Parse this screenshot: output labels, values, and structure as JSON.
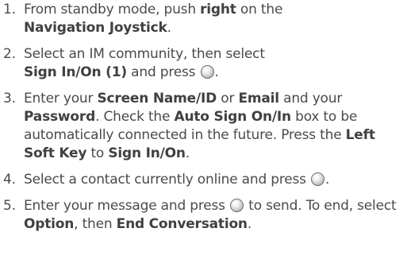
{
  "steps": [
    {
      "num": "1.",
      "parts": [
        {
          "t": "From standby mode, push "
        },
        {
          "b": "right"
        },
        {
          "t": " on the "
        },
        {
          "b": "Navigation Joystick"
        },
        {
          "t": "."
        }
      ]
    },
    {
      "num": "2.",
      "parts": [
        {
          "t": "Select an IM community, then select "
        },
        {
          "b": "Sign In/On (1)"
        },
        {
          "t": " and press "
        },
        {
          "icon": "ok-key-icon"
        },
        {
          "t": "."
        }
      ]
    },
    {
      "num": "3.",
      "parts": [
        {
          "t": "Enter your "
        },
        {
          "b": "Screen Name/ID"
        },
        {
          "t": " or "
        },
        {
          "b": "Email"
        },
        {
          "t": " and your "
        },
        {
          "b": "Password"
        },
        {
          "t": ". Check the "
        },
        {
          "b": "Auto Sign On/In"
        },
        {
          "t": " box to be automatically connected in the future. Press the "
        },
        {
          "b": "Left Soft Key"
        },
        {
          "t": " to "
        },
        {
          "b": "Sign In/On"
        },
        {
          "t": "."
        }
      ]
    },
    {
      "num": "4.",
      "parts": [
        {
          "t": "Select a contact currently online and press "
        },
        {
          "icon": "ok-key-icon"
        },
        {
          "t": "."
        }
      ]
    },
    {
      "num": "5.",
      "parts": [
        {
          "t": "Enter your message and press "
        },
        {
          "icon": "ok-key-icon"
        },
        {
          "t": " to send. To end, select "
        },
        {
          "b": "Option"
        },
        {
          "t": ", then "
        },
        {
          "b": "End Conversation"
        },
        {
          "t": "."
        }
      ]
    }
  ]
}
